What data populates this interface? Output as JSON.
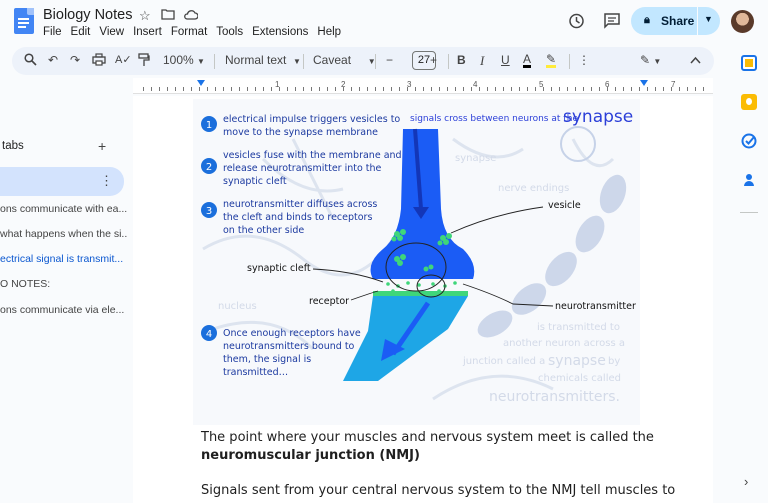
{
  "app": {
    "doc_title": "Biology Notes",
    "menu": [
      "File",
      "Edit",
      "View",
      "Insert",
      "Format",
      "Tools",
      "Extensions",
      "Help"
    ],
    "share_label": "Share",
    "colors": {
      "accent": "#1a73e8",
      "share_bg": "#c2e7ff",
      "sidebar_active": "#d3e3fd",
      "toolbar_bg": "#edf2fa"
    }
  },
  "toolbar": {
    "zoom": "100%",
    "style": "Normal text",
    "font": "Caveat",
    "font_size": "27"
  },
  "ruler": {
    "numbers": [
      "1",
      "2",
      "3",
      "4",
      "5",
      "6",
      "7"
    ]
  },
  "sidebar": {
    "heading": "tabs",
    "items": [
      "ons communicate with ea...",
      "what happens when the si...",
      "ectrical signal is transmit...",
      "O NOTES:",
      "ons communicate via ele..."
    ]
  },
  "illustration": {
    "header_small": "signals cross between neurons at the",
    "header_big": "synapse",
    "steps": [
      {
        "num": "1",
        "lines": [
          "electrical impulse triggers vesicles to",
          "move to the synapse membrane"
        ]
      },
      {
        "num": "2",
        "lines": [
          "vesicles fuse with the membrane and",
          "release neurotransmitter into the",
          "synaptic cleft"
        ]
      },
      {
        "num": "3",
        "lines": [
          "neurotransmitter diffuses across",
          "the cleft and binds to receptors",
          "on the other side"
        ]
      },
      {
        "num": "4",
        "lines": [
          "Once enough receptors have",
          "neurotransmitters bound to",
          "them, the signal is",
          "transmitted…"
        ]
      }
    ],
    "labels": {
      "vesicle": "vesicle",
      "synaptic_cleft": "synaptic cleft",
      "receptor": "receptor",
      "neurotransmitter": "neurotransmitter"
    },
    "bg_words": {
      "synapse": "synapse",
      "nerve_endings": "nerve endings",
      "nucleus": "nucleus",
      "line1": "is transmitted to",
      "line2": "another neuron across a",
      "line3a": "junction called a",
      "line3b": "synapse",
      "line3c": "by",
      "line4": "chemicals called",
      "line5": "neurotransmitters."
    }
  },
  "document": {
    "para1_line1": "The point where your muscles and nervous system meet is called the",
    "para1_line2": "neuromuscular junction (NMJ)",
    "para2_line1": "Signals sent from your central nervous system to the NMJ tell muscles to"
  }
}
